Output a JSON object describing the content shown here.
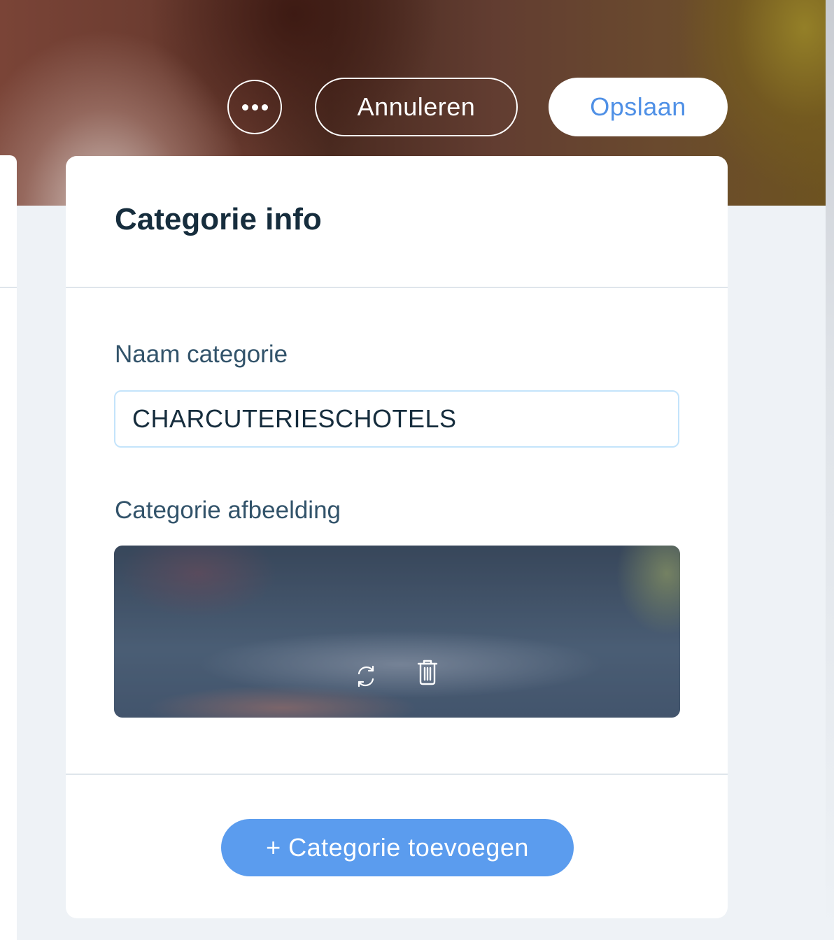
{
  "toolbar": {
    "more_icon": "more-horizontal-icon",
    "cancel_label": "Annuleren",
    "save_label": "Opslaan"
  },
  "card": {
    "title": "Categorie info",
    "name_label": "Naam categorie",
    "name_value": "CHARCUTERIESCHOTELS",
    "image_label": "Categorie afbeelding",
    "image_actions": [
      "replace-icon",
      "trash-icon"
    ],
    "add_button_label": "+ Categorie toevoegen"
  },
  "colors": {
    "accent": "#5b9cee",
    "save_text": "#4f90e6",
    "text_primary": "#162d3d",
    "input_border": "#c4e4fb"
  }
}
